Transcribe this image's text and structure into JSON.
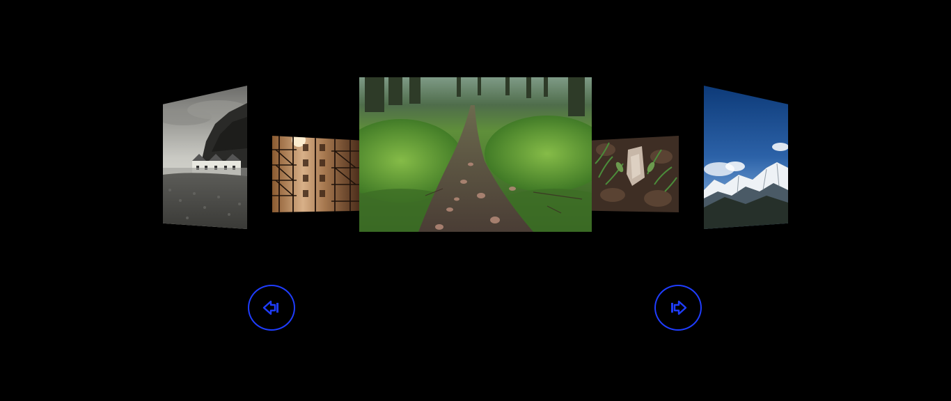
{
  "carousel": {
    "slides": [
      {
        "icon": "coastal-cliff-photo"
      },
      {
        "icon": "fire-escape-building-photo"
      },
      {
        "icon": "forest-trail-photo"
      },
      {
        "icon": "forest-floor-photo"
      },
      {
        "icon": "snowy-mountains-photo"
      }
    ],
    "active_index": 2
  },
  "controls": {
    "prev_icon": "arrow-left-icon",
    "next_icon": "arrow-right-icon",
    "accent_color": "#1f3dff"
  },
  "colors": {
    "background": "#000000"
  }
}
